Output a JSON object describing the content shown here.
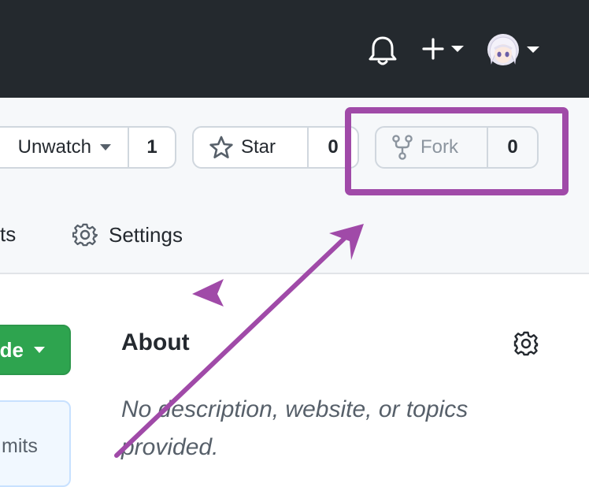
{
  "header": {
    "icons": [
      "bell-icon",
      "plus-icon",
      "chevron-down-icon",
      "avatar",
      "chevron-down-icon"
    ]
  },
  "actions": {
    "watch": {
      "label": "Unwatch",
      "count": "1"
    },
    "star": {
      "label": "Star",
      "count": "0"
    },
    "fork": {
      "label": "Fork",
      "count": "0"
    }
  },
  "tabs": {
    "partial_label": "ts",
    "settings_label": "Settings"
  },
  "code_button": {
    "label": "de"
  },
  "commits": {
    "label": "mits"
  },
  "about": {
    "title": "About",
    "description": "No description, website, or topics provided."
  },
  "colors": {
    "header_bg": "#24292e",
    "annotation": "#a04aa8",
    "code_green": "#2ea44f"
  }
}
